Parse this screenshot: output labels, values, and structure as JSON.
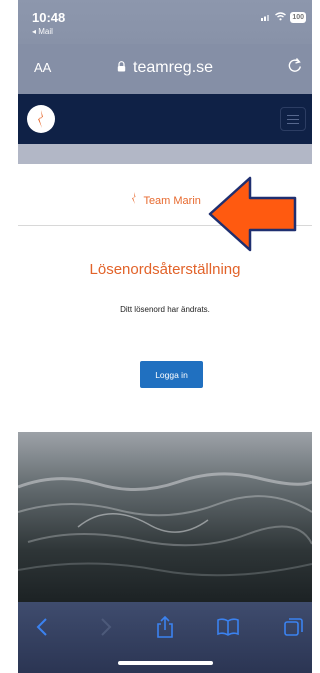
{
  "status_bar": {
    "time": "10:48",
    "back_app": "◂ Mail",
    "battery": "100"
  },
  "browser": {
    "text_size_label": "AA",
    "url": "teamreg.se"
  },
  "site": {
    "brand": "Team Marin",
    "heading": "Lösenordsåterställning",
    "message": "Ditt lösenord har ändrats.",
    "login_button": "Logga in"
  },
  "icons": {
    "status": [
      "signal-icon",
      "wifi-icon",
      "battery-icon"
    ],
    "browser": [
      "lock-icon",
      "reload-icon"
    ],
    "toolbar": [
      "back-icon",
      "forward-icon",
      "share-icon",
      "bookmarks-icon",
      "tabs-icon"
    ],
    "annotation": "arrow-pointer"
  },
  "colors": {
    "navbar": "#0f2146",
    "brand_orange": "#e76a2f",
    "button_blue": "#2070c0",
    "arrow_fill": "#ff5a10",
    "arrow_border": "#1f2f70"
  }
}
